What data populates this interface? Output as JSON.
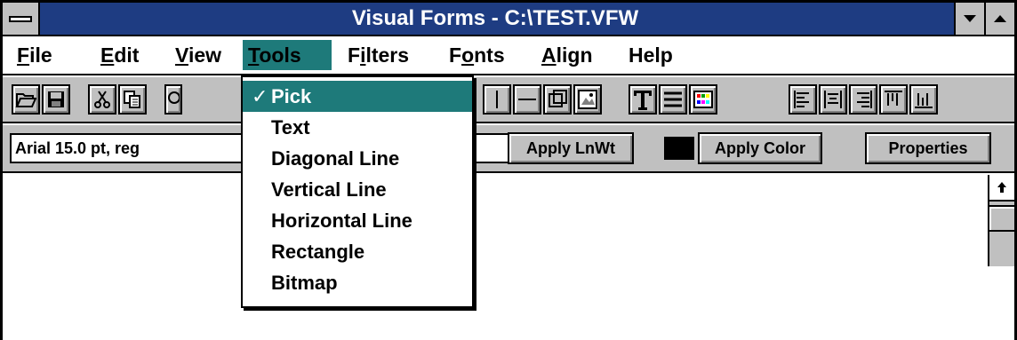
{
  "window": {
    "title": "Visual Forms - C:\\TEST.VFW"
  },
  "menubar": {
    "items": [
      {
        "label": "File",
        "hotkey": "F",
        "rest": "ile"
      },
      {
        "label": "Edit",
        "hotkey": "E",
        "rest": "dit"
      },
      {
        "label": "View",
        "hotkey": "V",
        "rest": "iew"
      },
      {
        "label": "Tools",
        "hotkey": "T",
        "rest": "ools"
      },
      {
        "label": "Filters",
        "pre": "F",
        "hotkey": "i",
        "rest": "lters"
      },
      {
        "label": "Fonts",
        "pre": "F",
        "hotkey": "o",
        "rest": "nts"
      },
      {
        "label": "Align",
        "hotkey": "A",
        "rest": "lign"
      },
      {
        "label": "Help",
        "hotkey": "",
        "rest": "Help"
      }
    ],
    "active": "Tools"
  },
  "formatbar": {
    "font_value": "Arial 15.0 pt, reg",
    "apply_lnwt": "Apply LnWt",
    "apply_color": "Apply Color",
    "properties": "Properties",
    "current_color": "#000000"
  },
  "tools_menu": {
    "items": [
      {
        "label": "Pick",
        "checked": true
      },
      {
        "label": "Text",
        "checked": false
      },
      {
        "label": "Diagonal Line",
        "checked": false
      },
      {
        "label": "Vertical Line",
        "checked": false
      },
      {
        "label": "Horizontal Line",
        "checked": false
      },
      {
        "label": "Rectangle",
        "checked": false
      },
      {
        "label": "Bitmap",
        "checked": false
      }
    ],
    "check_glyph": "✓"
  },
  "colors": {
    "titlebar": "#1e3c82",
    "highlight": "#1e7a7a",
    "chrome": "#c0c0c0"
  }
}
